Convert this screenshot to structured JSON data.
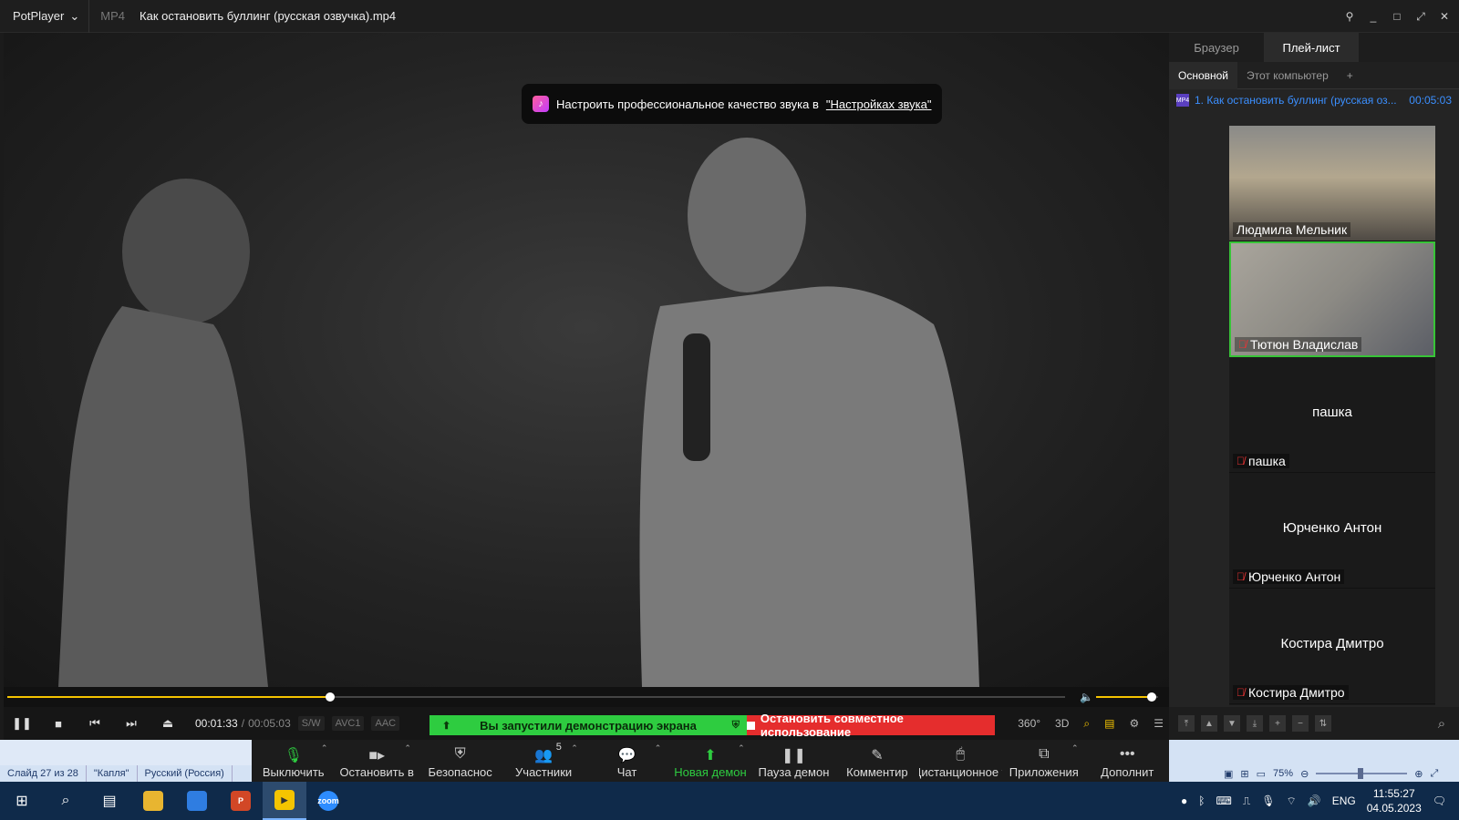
{
  "titlebar": {
    "app_name": "PotPlayer",
    "format": "MP4",
    "title": "Как остановить буллинг (русская озвучка).mp4"
  },
  "notice": {
    "text": "Настроить профессиональное качество звука в",
    "link": "\"Настройках звука\""
  },
  "player": {
    "progress": 0.305,
    "volume": 0.9,
    "time_current": "00:01:33",
    "time_separator": "/",
    "time_total": "00:05:03",
    "tags": [
      "S/W",
      "AVC1",
      "AAC"
    ],
    "right_labels": [
      "360°",
      "3D"
    ]
  },
  "share_banner": {
    "sharing_text": "Вы запустили демонстрацию экрана",
    "stop_text": "Остановить совместное использование"
  },
  "panel": {
    "tabs": [
      "Браузер",
      "Плей-лист"
    ],
    "subtabs": [
      "Основной",
      "Этот компьютер",
      "+"
    ],
    "playlist": [
      {
        "title": "1. Как остановить буллинг (русская оз...",
        "duration": "00:05:03"
      }
    ]
  },
  "participants": [
    {
      "name": "Людмила Мельник",
      "video": true,
      "muted": false
    },
    {
      "name": "Тютюн Владислав",
      "video": true,
      "muted": true
    },
    {
      "name": "пашка",
      "video": false,
      "muted": true
    },
    {
      "name": "Юрченко Антон",
      "video": false,
      "muted": true
    },
    {
      "name": "Костира Дмитро",
      "video": false,
      "muted": true
    }
  ],
  "zoom_toolbar": {
    "mute": "Выключить",
    "video": "Остановить в",
    "security": "Безопаснос",
    "participants": "Участники",
    "participants_count": "5",
    "chat": "Чат",
    "new_share": "Новая демон",
    "pause_share": "Пауза демон",
    "annotate": "Комментир",
    "remote": "Дистанционное у",
    "apps": "Приложения",
    "more": "Дополнит"
  },
  "powerpoint": {
    "slide": "Слайд 27 из 28",
    "theme": "\"Капля\"",
    "language": "Русский (Россия)",
    "zoom": "75%"
  },
  "taskbar": {
    "language": "ENG",
    "time": "11:55:27",
    "date": "04.05.2023"
  },
  "colors": {
    "accent": "#f5c400",
    "share_green": "#2ecc40",
    "share_red": "#e52d2d",
    "playlist_link": "#3b8fff",
    "taskbar": "#0f2a4a"
  }
}
